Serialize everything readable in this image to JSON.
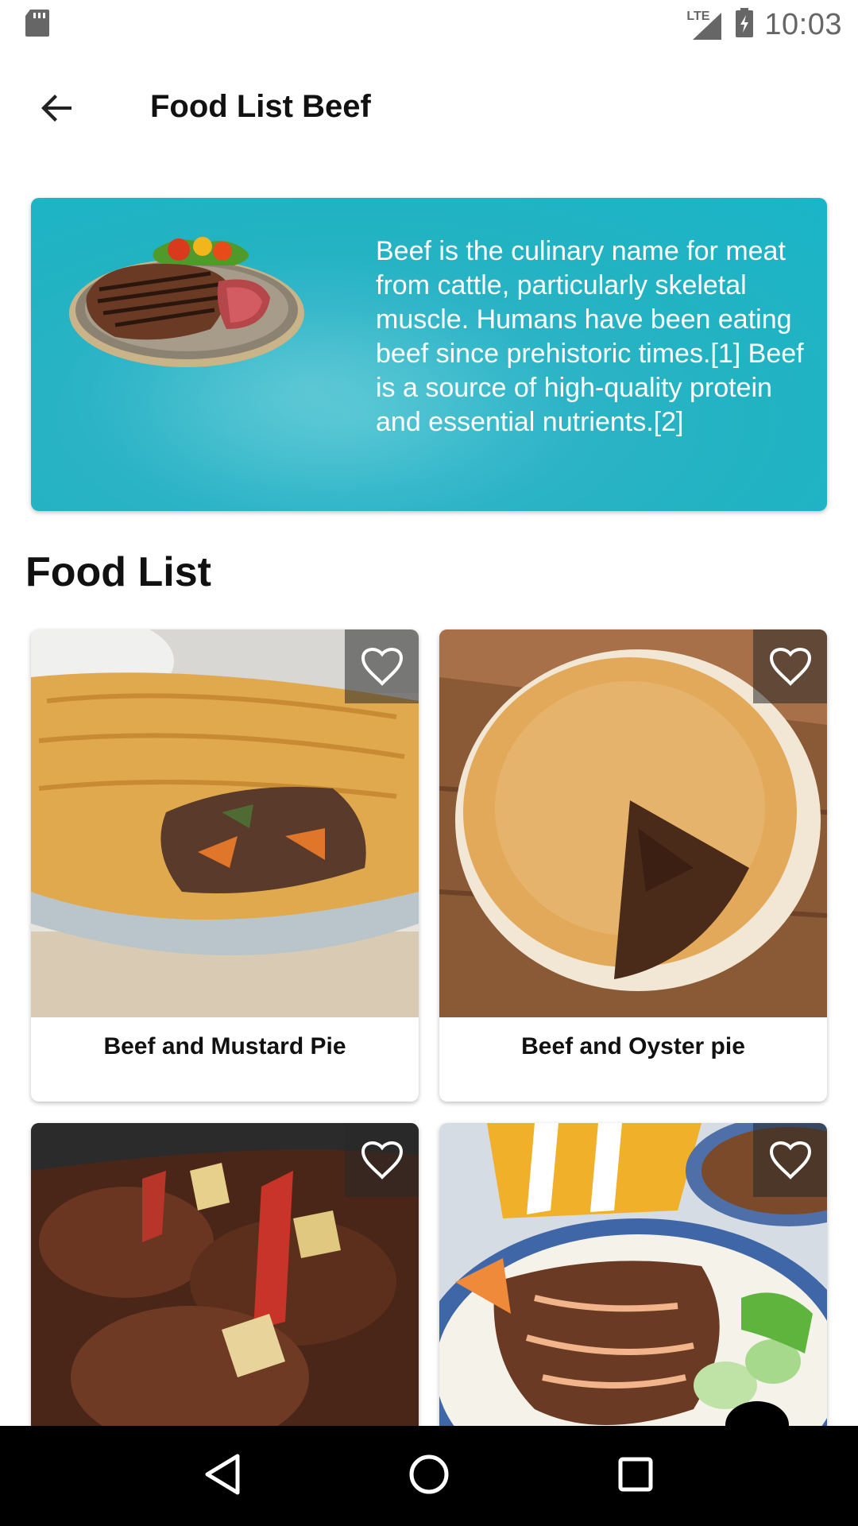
{
  "status_bar": {
    "time": "10:03",
    "network": "LTE",
    "icons": [
      "sd-card-icon",
      "signal-icon",
      "battery-charging-icon"
    ]
  },
  "toolbar": {
    "title": "Food List Beef",
    "back_icon": "arrow-back-icon"
  },
  "banner": {
    "description": "Beef is the culinary name for meat from cattle, particularly skeletal muscle. Humans have been eating beef since prehistoric times.[1] Beef is a source of high-quality protein and essential nutrients.[2]"
  },
  "section": {
    "title": "Food List"
  },
  "foods": [
    {
      "name": "Beef and Mustard Pie",
      "favorite": false,
      "icon": "heart-outline-icon"
    },
    {
      "name": "Beef and Oyster pie",
      "favorite": false,
      "icon": "heart-outline-icon"
    },
    {
      "name": "",
      "favorite": false,
      "icon": "heart-outline-icon"
    },
    {
      "name": "",
      "favorite": false,
      "icon": "heart-outline-icon"
    }
  ],
  "nav_bar": {
    "icons": [
      "back-triangle-icon",
      "home-circle-icon",
      "recents-square-icon"
    ]
  },
  "colors": {
    "banner_teal": "#22b3c3",
    "text_primary": "#111111",
    "nav_bar": "#000000"
  }
}
